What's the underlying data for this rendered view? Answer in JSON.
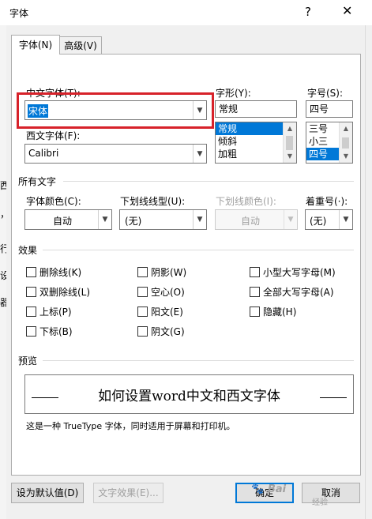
{
  "window": {
    "title": "字体",
    "help_label": "?",
    "close_label": "✕"
  },
  "tabs": [
    {
      "label": "字体(N)",
      "active": true
    },
    {
      "label": "高级(V)",
      "active": false
    }
  ],
  "fonts": {
    "chinese_font_label": "中文字体(T):",
    "chinese_font_value": "宋体",
    "western_font_label": "西文字体(F):",
    "western_font_value": "Calibri",
    "style_label": "字形(Y):",
    "style_value": "常规",
    "style_options": [
      "常规",
      "倾斜",
      "加粗"
    ],
    "style_selected": "常规",
    "size_label": "字号(S):",
    "size_value": "四号",
    "size_options": [
      "三号",
      "小三",
      "四号"
    ],
    "size_selected": "四号"
  },
  "all_text": {
    "group_label": "所有文字",
    "font_color_label": "字体颜色(C):",
    "font_color_value": "自动",
    "underline_style_label": "下划线线型(U):",
    "underline_style_value": "(无)",
    "underline_color_label": "下划线颜色(I):",
    "underline_color_value": "自动",
    "emphasis_label": "着重号(·):",
    "emphasis_value": "(无)"
  },
  "effects": {
    "group_label": "效果",
    "items": [
      {
        "label": "删除线(K)",
        "checked": false
      },
      {
        "label": "阴影(W)",
        "checked": false
      },
      {
        "label": "小型大写字母(M)",
        "checked": false
      },
      {
        "label": "双删除线(L)",
        "checked": false
      },
      {
        "label": "空心(O)",
        "checked": false
      },
      {
        "label": "全部大写字母(A)",
        "checked": false
      },
      {
        "label": "上标(P)",
        "checked": false
      },
      {
        "label": "阳文(E)",
        "checked": false
      },
      {
        "label": "隐藏(H)",
        "checked": false
      },
      {
        "label": "下标(B)",
        "checked": false
      },
      {
        "label": "阴文(G)",
        "checked": false
      }
    ]
  },
  "preview": {
    "group_label": "预览",
    "sample_text": "如何设置word中文和西文字体",
    "description": "这是一种 TrueType 字体，同时适用于屏幕和打印机。"
  },
  "buttons": {
    "set_default": "设为默认值(D)",
    "text_effects": "文字效果(E)...",
    "ok": "确定",
    "cancel": "取消"
  },
  "background_fragments": [
    "西",
    "，",
    "行",
    "设",
    "器"
  ],
  "watermark": {
    "paw": "🐾",
    "text": "Bai",
    "suffix": "经验"
  },
  "colors": {
    "highlight_border": "#d7222a",
    "selection": "#0078d7"
  }
}
